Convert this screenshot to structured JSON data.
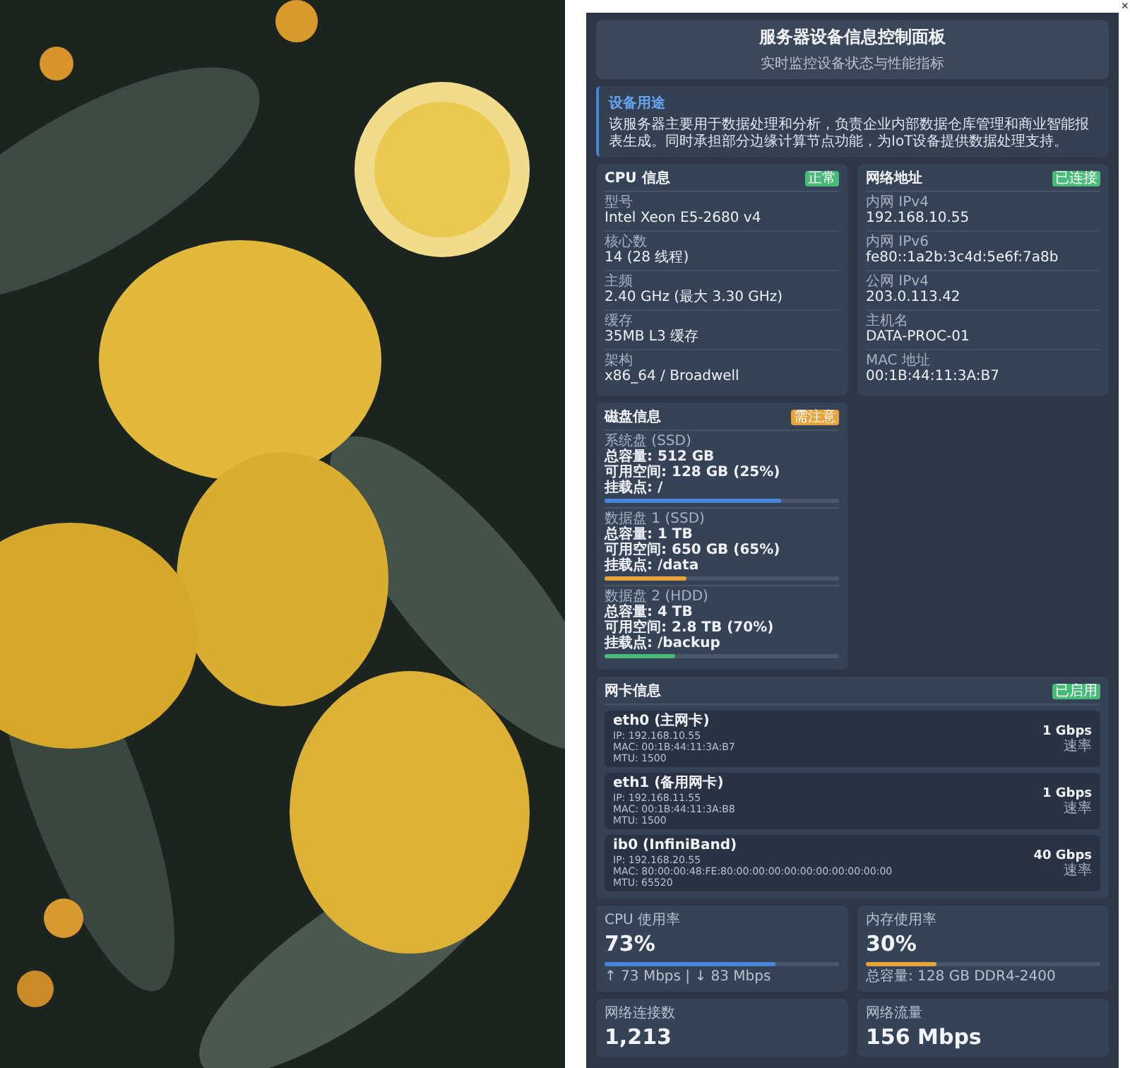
{
  "close": "×",
  "header": {
    "title": "服务器设备信息控制面板",
    "subtitle": "实时监控设备状态与性能指标"
  },
  "purpose": {
    "title": "设备用途",
    "text": "该服务器主要用于数据处理和分析，负责企业内部数据仓库管理和商业智能报表生成。同时承担部分边缘计算节点功能，为IoT设备提供数据处理支持。"
  },
  "cpu": {
    "title": "CPU 信息",
    "badge": {
      "text": "正常",
      "color": "#48bb78"
    },
    "fields": [
      {
        "label": "型号",
        "value": "Intel Xeon E5-2680 v4"
      },
      {
        "label": "核心数",
        "value": "14 (28 线程)"
      },
      {
        "label": "主频",
        "value": "2.40 GHz (最大 3.30 GHz)"
      },
      {
        "label": "缓存",
        "value": "35MB L3 缓存"
      },
      {
        "label": "架构",
        "value": "x86_64 / Broadwell"
      }
    ]
  },
  "network": {
    "title": "网络地址",
    "badge": {
      "text": "已连接",
      "color": "#48bb78"
    },
    "fields": [
      {
        "label": "内网 IPv4",
        "value": "192.168.10.55"
      },
      {
        "label": "内网 IPv6",
        "value": "fe80::1a2b:3c4d:5e6f:7a8b"
      },
      {
        "label": "公网 IPv4",
        "value": "203.0.113.42"
      },
      {
        "label": "主机名",
        "value": "DATA-PROC-01"
      },
      {
        "label": "MAC 地址",
        "value": "00:1B:44:11:3A:B7"
      }
    ]
  },
  "disk": {
    "title": "磁盘信息",
    "badge": {
      "text": "需注意",
      "color": "#e8a33a"
    },
    "disks": [
      {
        "name": "系统盘 (SSD)",
        "total": "总容量: 512 GB",
        "free": "可用空间: 128 GB (25%)",
        "mount": "挂载点: /",
        "level": 0.75,
        "color": "#4a86d8"
      },
      {
        "name": "数据盘 1 (SSD)",
        "total": "总容量: 1 TB",
        "free": "可用空间: 650 GB (65%)",
        "mount": "挂载点: /data",
        "level": 0.35,
        "color": "#e8a33a"
      },
      {
        "name": "数据盘 2 (HDD)",
        "total": "总容量: 4 TB",
        "free": "可用空间: 2.8 TB (70%)",
        "mount": "挂载点: /backup",
        "level": 0.3,
        "color": "#48bb78"
      }
    ]
  },
  "nic": {
    "title": "网卡信息",
    "badge": {
      "text": "已启用",
      "color": "#48bb78"
    },
    "cards": [
      {
        "name": "eth0 (主网卡)",
        "ip": "IP: 192.168.10.55",
        "mac": "MAC: 00:1B:44:11:3A:B7",
        "mtu": "MTU: 1500",
        "speed": "1 Gbps",
        "speed_label": "速率"
      },
      {
        "name": "eth1 (备用网卡)",
        "ip": "IP: 192.168.11.55",
        "mac": "MAC: 00:1B:44:11:3A:B8",
        "mtu": "MTU: 1500",
        "speed": "1 Gbps",
        "speed_label": "速率"
      },
      {
        "name": "ib0 (InfiniBand)",
        "ip": "IP: 192.168.20.55",
        "mac": "MAC: 80:00:00:48:FE:80:00:00:00:00:00:00:00:00:00:00",
        "mtu": "MTU: 65520",
        "speed": "40 Gbps",
        "speed_label": "速率"
      }
    ]
  },
  "stats": [
    {
      "label": "CPU 使用率",
      "value": "73%",
      "level": 0.73,
      "color": "#4a86d8",
      "note": "↑ 73 Mbps | ↓ 83 Mbps"
    },
    {
      "label": "内存使用率",
      "value": "30%",
      "level": 0.3,
      "color": "#e8a33a",
      "note": "总容量: 128 GB DDR4-2400"
    },
    {
      "label": "网络连接数",
      "value": "1,213"
    },
    {
      "label": "网络流量",
      "value": "156 Mbps"
    }
  ]
}
